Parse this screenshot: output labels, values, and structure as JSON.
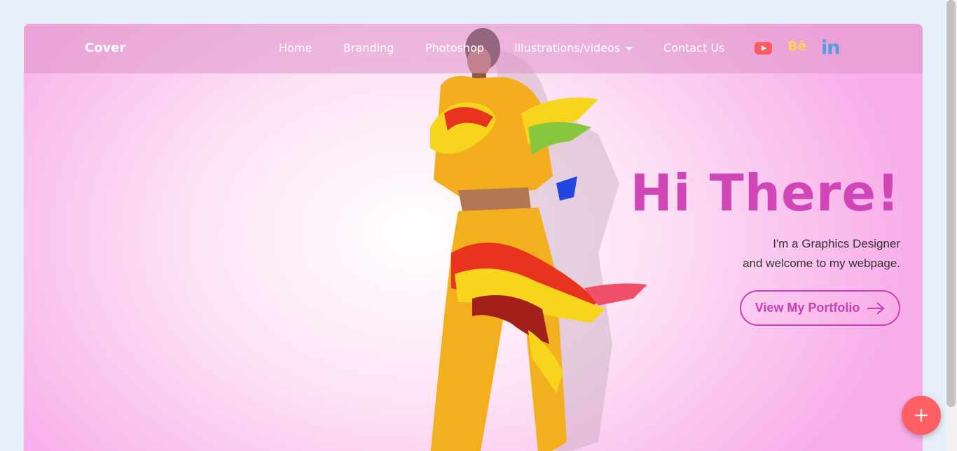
{
  "nav": {
    "brand": "Cover",
    "links": [
      "Home",
      "Branding",
      "Photoshop",
      "Illustrations/videos",
      "Contact Us"
    ],
    "social": {
      "youtube": "youtube-icon",
      "behance": "Bē",
      "linkedin": "in"
    }
  },
  "hero": {
    "title": "Hi There!",
    "subtitle_line1": "I'm a Graphics Designer",
    "subtitle_line2": "and welcome to my webpage.",
    "cta": "View My Portfolio"
  },
  "colors": {
    "accent": "#d046b7",
    "youtube": "#ff5a5f",
    "behance": "#ffd15e",
    "linkedin": "#4f9fe0",
    "fab": "#ff5f63"
  },
  "fab": {
    "icon": "plus-icon"
  }
}
